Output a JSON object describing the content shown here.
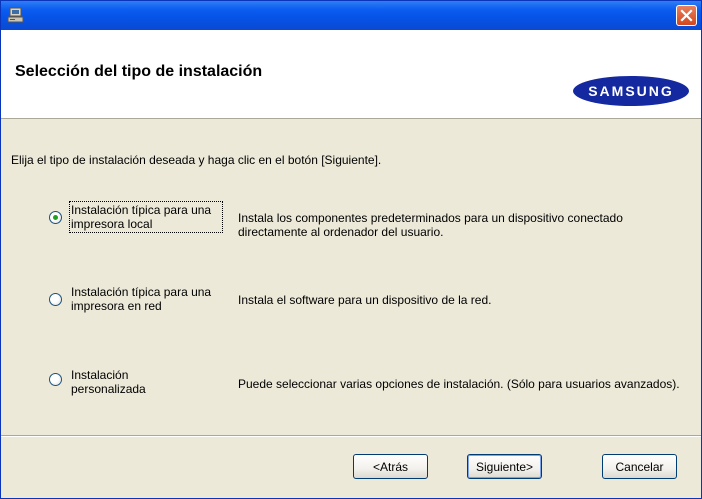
{
  "window": {
    "icon": "installer-computer-icon",
    "close_icon": "close-icon"
  },
  "header": {
    "title": "Selección del tipo de instalación",
    "logo_text": "SAMSUNG",
    "logo_color": "#1428a0"
  },
  "instruction": "Elija el tipo de instalación deseada y haga clic en el botón [Siguiente].",
  "options": [
    {
      "label": "Instalación típica para una impresora local",
      "description": "Instala los componentes predeterminados para un dispositivo conectado directamente al ordenador del usuario.",
      "selected": true
    },
    {
      "label": "Instalación típica para una impresora en red",
      "description": "Instala el software para un dispositivo de la red.",
      "selected": false
    },
    {
      "label": "Instalación personalizada",
      "description": "Puede seleccionar varias opciones de instalación. (Sólo para usuarios avanzados).",
      "selected": false
    }
  ],
  "buttons": {
    "back": "<Atrás",
    "next": "Siguiente>",
    "cancel": "Cancelar"
  },
  "colors": {
    "titlebar": "#0653e6",
    "dialog_bg": "#ece9d8",
    "radio_selected": "#21a121"
  }
}
